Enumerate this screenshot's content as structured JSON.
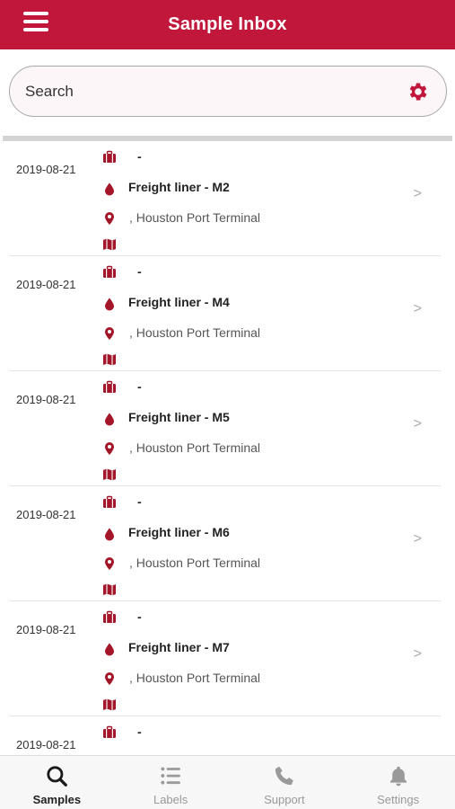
{
  "header": {
    "title": "Sample Inbox"
  },
  "search": {
    "placeholder": "Search"
  },
  "colors": {
    "brand": "#c0173a",
    "icon": "#a3162a"
  },
  "samples": [
    {
      "date": "2019-08-21",
      "line1": "-",
      "line2": "Freight liner - M2",
      "line3": ", Houston Port Terminal"
    },
    {
      "date": "2019-08-21",
      "line1": "-",
      "line2": "Freight liner - M4",
      "line3": ", Houston Port Terminal"
    },
    {
      "date": "2019-08-21",
      "line1": "-",
      "line2": "Freight liner - M5",
      "line3": ", Houston Port Terminal"
    },
    {
      "date": "2019-08-21",
      "line1": "-",
      "line2": "Freight liner - M6",
      "line3": ", Houston Port Terminal"
    },
    {
      "date": "2019-08-21",
      "line1": "-",
      "line2": "Freight liner - M7",
      "line3": ", Houston Port Terminal"
    },
    {
      "date": "2019-08-21",
      "line1": "-",
      "line2": "",
      "line3": ""
    }
  ],
  "chevron": ">",
  "tabs": [
    {
      "label": "Samples",
      "icon": "search-icon",
      "active": true
    },
    {
      "label": "Labels",
      "icon": "list-icon",
      "active": false
    },
    {
      "label": "Support",
      "icon": "phone-icon",
      "active": false
    },
    {
      "label": "Settings",
      "icon": "bell-icon",
      "active": false
    }
  ]
}
